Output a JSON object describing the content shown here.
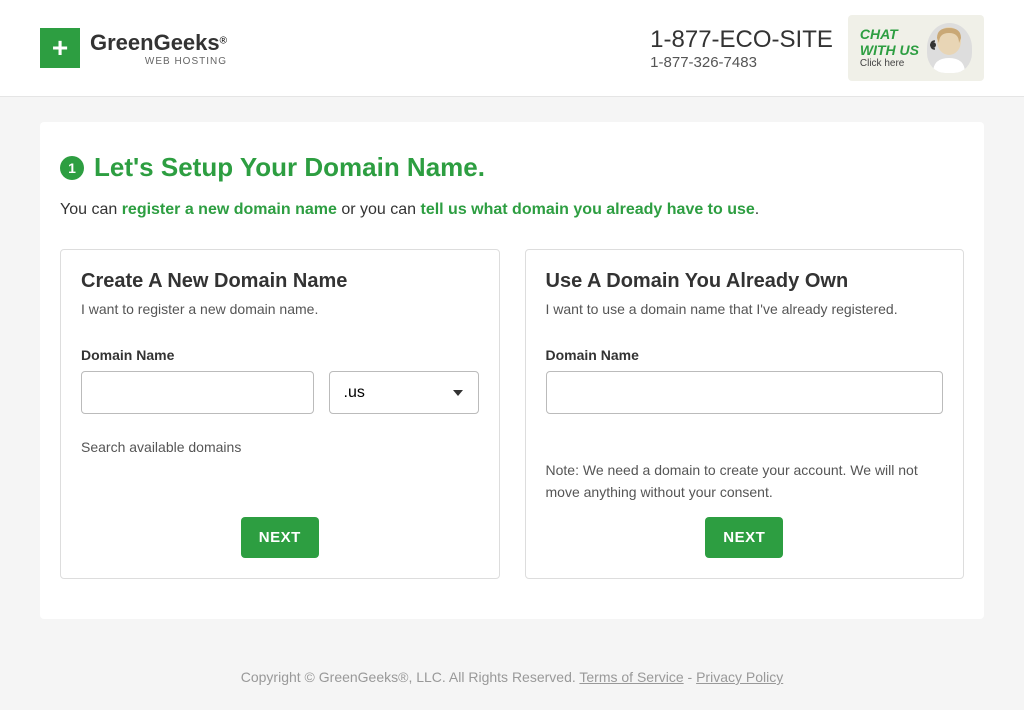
{
  "header": {
    "brand_name": "GreenGeeks",
    "brand_sup": "®",
    "brand_tagline": "WEB HOSTING",
    "phone_main": "1-877-ECO-SITE",
    "phone_secondary": "1-877-326-7483",
    "chat_line1": "CHAT",
    "chat_line2": "WITH US",
    "chat_click": "Click here"
  },
  "main": {
    "step_number": "1",
    "title": "Let's Setup Your Domain Name.",
    "intro_prefix": "You can ",
    "intro_link1": "register a new domain name",
    "intro_mid": " or you can ",
    "intro_link2": "tell us what domain you already have to use",
    "intro_suffix": "."
  },
  "card_new": {
    "title": "Create A New Domain Name",
    "subtitle": "I want to register a new domain name.",
    "field_label": "Domain Name",
    "input_value": "",
    "tld_selected": ".us",
    "helper_text": "Search available domains",
    "button_label": "NEXT"
  },
  "card_own": {
    "title": "Use A Domain You Already Own",
    "subtitle": "I want to use a domain name that I've already registered.",
    "field_label": "Domain Name",
    "input_value": "",
    "note": "Note: We need a domain to create your account. We will not move anything without your consent.",
    "button_label": "NEXT"
  },
  "footer": {
    "copyright": "Copyright © GreenGeeks®, LLC. All Rights Reserved. ",
    "tos_label": "Terms of Service",
    "separator": " - ",
    "privacy_label": "Privacy Policy"
  }
}
